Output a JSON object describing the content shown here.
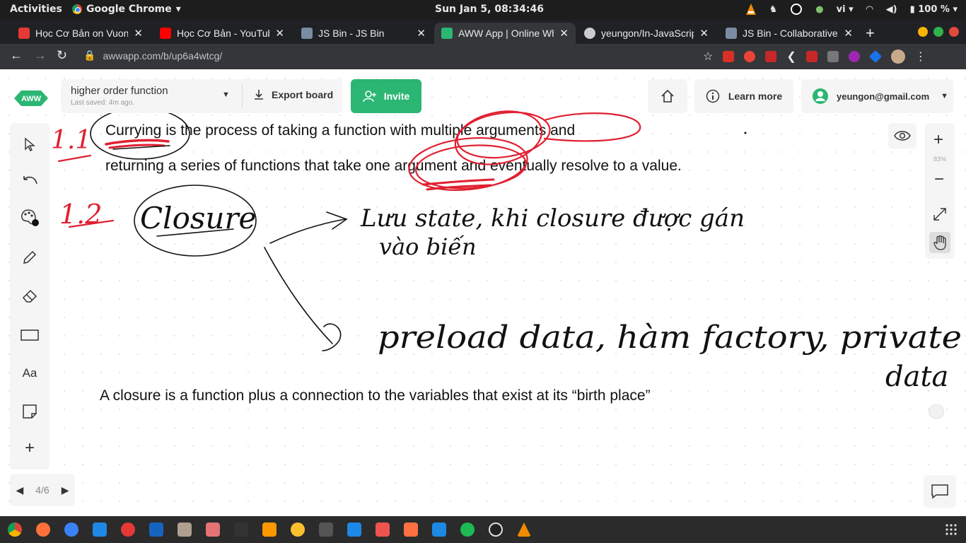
{
  "system_bar": {
    "activities": "Activities",
    "app_name": "Google Chrome",
    "clock": "Sun Jan  5, 08:34:46",
    "language": "vi",
    "battery": "100 %"
  },
  "tabs": [
    {
      "title": "Học Cơ Bản on Vuong",
      "favicon_color": "#e53935",
      "active": false
    },
    {
      "title": "Học Cơ Bản - YouTube",
      "favicon_color": "#ff0000",
      "active": false
    },
    {
      "title": "JS Bin - JS Bin",
      "favicon_color": "#7a8ca3",
      "active": false
    },
    {
      "title": "AWW App | Online Wh",
      "favicon_color": "#2bb673",
      "active": true
    },
    {
      "title": "yeungon/In-JavaScrip",
      "favicon_color": "#cccccc",
      "active": false
    },
    {
      "title": "JS Bin - Collaborative",
      "favicon_color": "#7a8ca3",
      "active": false
    }
  ],
  "address_bar": {
    "url": "awwapp.com/b/up6a4wtcg/"
  },
  "board": {
    "name": "higher order function",
    "last_saved": "Last saved: 4m ago.",
    "export_label": "Export board",
    "invite_label": "Invite",
    "learn_more_label": "Learn more",
    "user_email": "yeungon@gmail.com"
  },
  "canvas": {
    "currying_line1": "Currying is the process of taking a function with multiple arguments and",
    "currying_line2": "returning a series of functions that take one argument and eventually resolve to a value.",
    "closure_note": "A closure is a function plus a connection to the variables that exist at its “birth place”",
    "handwriting": {
      "label_1_1": "1.1",
      "label_1_2": "1.2",
      "closure_word": "Closure",
      "state_note_line1": "Lưu state, khi closure được gán",
      "state_note_line2": "vào biến",
      "uses_line1": "preload data, hàm factory, private",
      "uses_line2": "data"
    }
  },
  "zoom": {
    "level": "83%"
  },
  "pager": {
    "current": "4/6"
  },
  "colors": {
    "brand_green": "#2bb673",
    "ink_red": "#e02030",
    "ink_black": "#111111"
  }
}
